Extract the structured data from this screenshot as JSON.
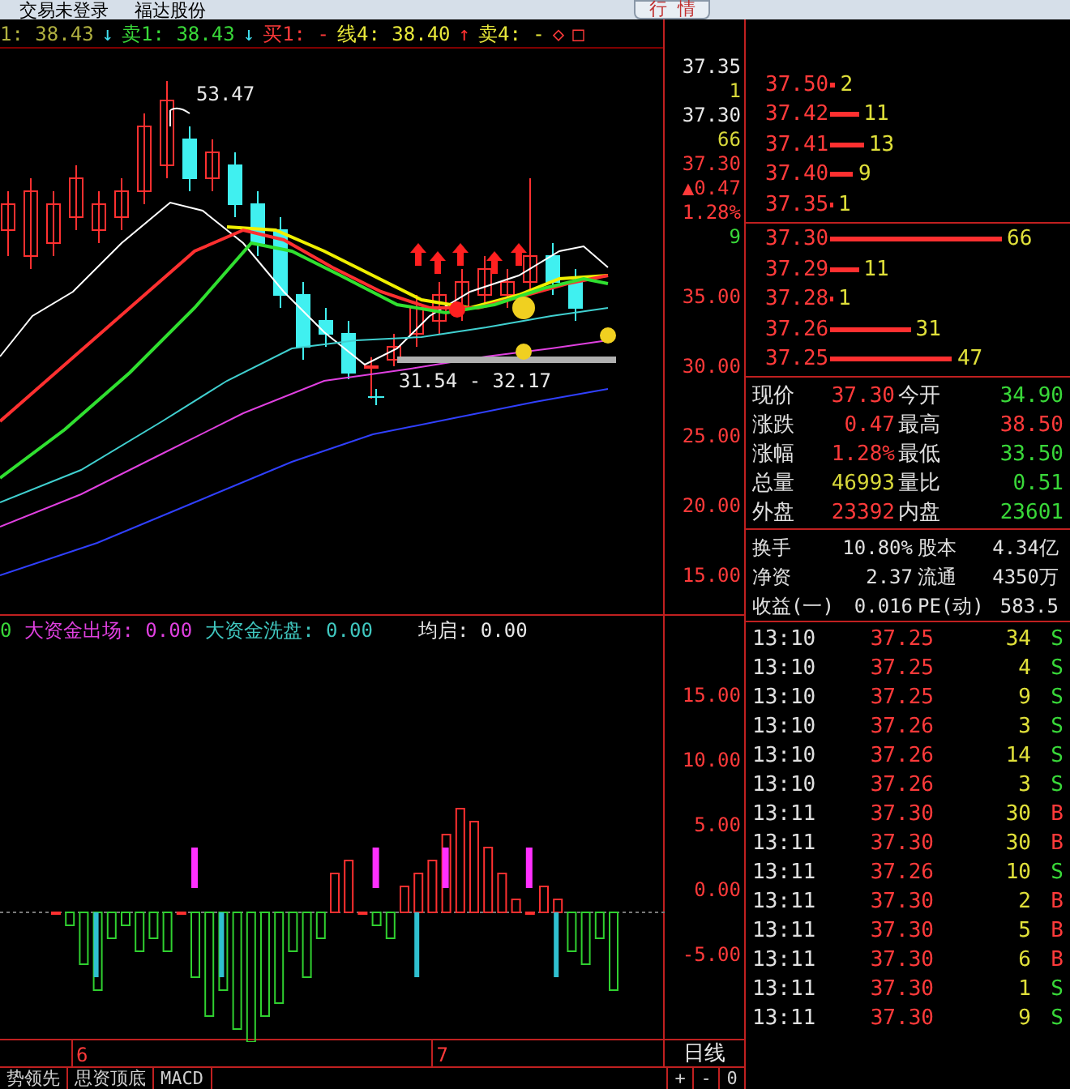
{
  "top_bar": {
    "texts": [
      "交易未登录",
      "福达股份"
    ],
    "button": "行 情"
  },
  "quote_line": [
    {
      "text": "1: 38.43",
      "kind": "olive"
    },
    {
      "text": "↓",
      "kind": "down"
    },
    {
      "text": "卖1: 38.43",
      "kind": "green"
    },
    {
      "text": "↓",
      "kind": "down"
    },
    {
      "text": "买1: -",
      "kind": "red"
    },
    {
      "text": "线4: 38.40",
      "kind": "yellow"
    },
    {
      "text": "↑",
      "kind": "up"
    },
    {
      "text": "卖4: -",
      "kind": "yellow"
    },
    {
      "text": "◇",
      "kind": "red"
    },
    {
      "text": "□",
      "kind": "red"
    }
  ],
  "main_chart": {
    "high_label": "53.47",
    "low_label": "31.54 - 32.17"
  },
  "axis_quote": [
    {
      "text": "37.35",
      "kind": "plain"
    },
    {
      "text": "1",
      "kind": "vol"
    },
    {
      "text": "37.30",
      "kind": "plain"
    },
    {
      "text": "66",
      "kind": "vol"
    },
    {
      "text": "37.30",
      "kind": "up"
    },
    {
      "text": "0.47",
      "kind": "up",
      "prefix": "▲"
    },
    {
      "text": "1.28%",
      "kind": "up"
    },
    {
      "text": "9",
      "kind": "down"
    }
  ],
  "price_axis": [
    "35.00",
    "30.00",
    "25.00",
    "20.00",
    "15.00"
  ],
  "indicator_legend": [
    {
      "text": "0",
      "kind": "green"
    },
    {
      "text": "大资金出场: 0.00",
      "kind": "magenta"
    },
    {
      "text": "大资金洗盘: 0.00",
      "kind": "teal"
    },
    {
      "text": "均启: 0.00",
      "kind": "plain"
    }
  ],
  "indicator_axis": [
    "15.00",
    "10.00",
    "5.00",
    "0.00",
    "-5.00"
  ],
  "date_axis": [
    "6",
    "7"
  ],
  "period_label": "日线",
  "bottom_tabs": [
    "势领先",
    "思资顶底",
    "MACD"
  ],
  "zoom_buttons": [
    "+",
    "-",
    "0"
  ],
  "asks": [
    {
      "price": "37.50",
      "volume": "2"
    },
    {
      "price": "37.42",
      "volume": "11"
    },
    {
      "price": "37.41",
      "volume": "13"
    },
    {
      "price": "37.40",
      "volume": "9"
    },
    {
      "price": "37.35",
      "volume": "1"
    }
  ],
  "bids": [
    {
      "price": "37.30",
      "volume": "66"
    },
    {
      "price": "37.29",
      "volume": "11"
    },
    {
      "price": "37.28",
      "volume": "1"
    },
    {
      "price": "37.26",
      "volume": "31"
    },
    {
      "price": "37.25",
      "volume": "47"
    }
  ],
  "stats": [
    {
      "label": "现价",
      "value": "37.30",
      "kind": "up"
    },
    {
      "label": "今开",
      "value": "34.90",
      "kind": "down"
    },
    {
      "label": "涨跌",
      "value": "0.47",
      "kind": "up"
    },
    {
      "label": "最高",
      "value": "38.50",
      "kind": "up"
    },
    {
      "label": "涨幅",
      "value": "1.28%",
      "kind": "up"
    },
    {
      "label": "最低",
      "value": "33.50",
      "kind": "down"
    },
    {
      "label": "总量",
      "value": "46993",
      "kind": "vol"
    },
    {
      "label": "量比",
      "value": "0.51",
      "kind": "down"
    },
    {
      "label": "外盘",
      "value": "23392",
      "kind": "up"
    },
    {
      "label": "内盘",
      "value": "23601",
      "kind": "down"
    }
  ],
  "fundamentals": [
    {
      "label": "换手",
      "value": "10.80%"
    },
    {
      "label": "股本",
      "value": "4.34亿"
    },
    {
      "label": "净资",
      "value": "2.37"
    },
    {
      "label": "流通",
      "value": "4350万"
    },
    {
      "label": "收益(一)",
      "value": "0.016"
    },
    {
      "label": "PE(动)",
      "value": "583.5"
    }
  ],
  "trades": [
    {
      "time": "13:10",
      "price": "37.25",
      "volume": "34",
      "side": "S",
      "kind": "sell"
    },
    {
      "time": "13:10",
      "price": "37.25",
      "volume": "4",
      "side": "S",
      "kind": "sell"
    },
    {
      "time": "13:10",
      "price": "37.25",
      "volume": "9",
      "side": "S",
      "kind": "sell"
    },
    {
      "time": "13:10",
      "price": "37.26",
      "volume": "3",
      "side": "S",
      "kind": "sell"
    },
    {
      "time": "13:10",
      "price": "37.26",
      "volume": "14",
      "side": "S",
      "kind": "sell"
    },
    {
      "time": "13:10",
      "price": "37.26",
      "volume": "3",
      "side": "S",
      "kind": "sell"
    },
    {
      "time": "13:11",
      "price": "37.30",
      "volume": "30",
      "side": "B",
      "kind": "buy"
    },
    {
      "time": "13:11",
      "price": "37.30",
      "volume": "30",
      "side": "B",
      "kind": "buy"
    },
    {
      "time": "13:11",
      "price": "37.26",
      "volume": "10",
      "side": "S",
      "kind": "sell"
    },
    {
      "time": "13:11",
      "price": "37.30",
      "volume": "2",
      "side": "B",
      "kind": "buy"
    },
    {
      "time": "13:11",
      "price": "37.30",
      "volume": "5",
      "side": "B",
      "kind": "buy"
    },
    {
      "time": "13:11",
      "price": "37.30",
      "volume": "6",
      "side": "B",
      "kind": "buy"
    },
    {
      "time": "13:11",
      "price": "37.30",
      "volume": "1",
      "side": "S",
      "kind": "sell"
    },
    {
      "time": "13:11",
      "price": "37.30",
      "volume": "9",
      "side": "S",
      "kind": "sell"
    }
  ]
}
